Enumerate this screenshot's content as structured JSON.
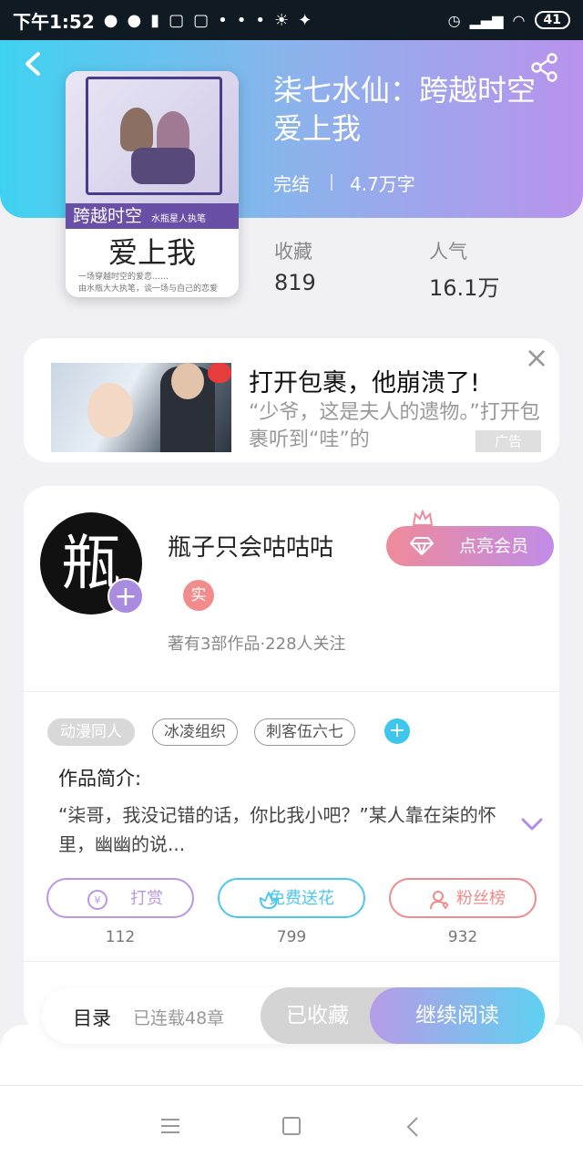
{
  "status_bar": {
    "time": "下午1:52",
    "battery": "41"
  },
  "book": {
    "title": "柒七水仙：跨越时空爱上我",
    "status": "完结",
    "words": "4.7万字",
    "stats": [
      {
        "label": "收藏",
        "value": "819"
      },
      {
        "label": "人气",
        "value": "16.1万"
      }
    ],
    "cover": {
      "band_text": "跨越时空",
      "band_small": "水瓶星人执笔",
      "big_text": "爱上我",
      "small_lines": [
        "一场穿越时空的爱恋……",
        "由水瓶大大执笔，谈一场与自己的恋爱"
      ]
    }
  },
  "ad": {
    "title": "打开包裹，他崩溃了!",
    "description": "“少爷，这是夫人的遗物。”打开包裹听到“哇”的",
    "badge": "广告"
  },
  "author": {
    "avatar_text": "瓶",
    "name": "瓶子只会咕咕咕",
    "real_badge": "实",
    "stats": "著有3部作品·228人关注",
    "vip_button": "点亮会员"
  },
  "tags": [
    {
      "label": "动漫同人",
      "style": "filled"
    },
    {
      "label": "冰凌组织",
      "style": "outline"
    },
    {
      "label": "刺客伍六七",
      "style": "outline"
    }
  ],
  "intro": {
    "label": "作品简介:",
    "text": "“柒哥，我没记错的话，你比我小吧？”某人靠在柒的怀里，幽幽的说..."
  },
  "actions": [
    {
      "label": "打赏",
      "count": "112",
      "color": "#b996e6"
    },
    {
      "label": "免费送花",
      "count": "799",
      "color": "#4cc8ee"
    },
    {
      "label": "粉丝榜",
      "count": "932",
      "color": "#ef8b8b"
    }
  ],
  "bottom_bar": {
    "toc": "目录",
    "toc_sub": "已连载48章",
    "fav": "已收藏",
    "read": "继续阅读"
  },
  "colors": {
    "header_start": "#3fd2f0",
    "header_end": "#b993ec",
    "accent_blue": "#3fc6ef",
    "accent_purple": "#a98be0"
  }
}
